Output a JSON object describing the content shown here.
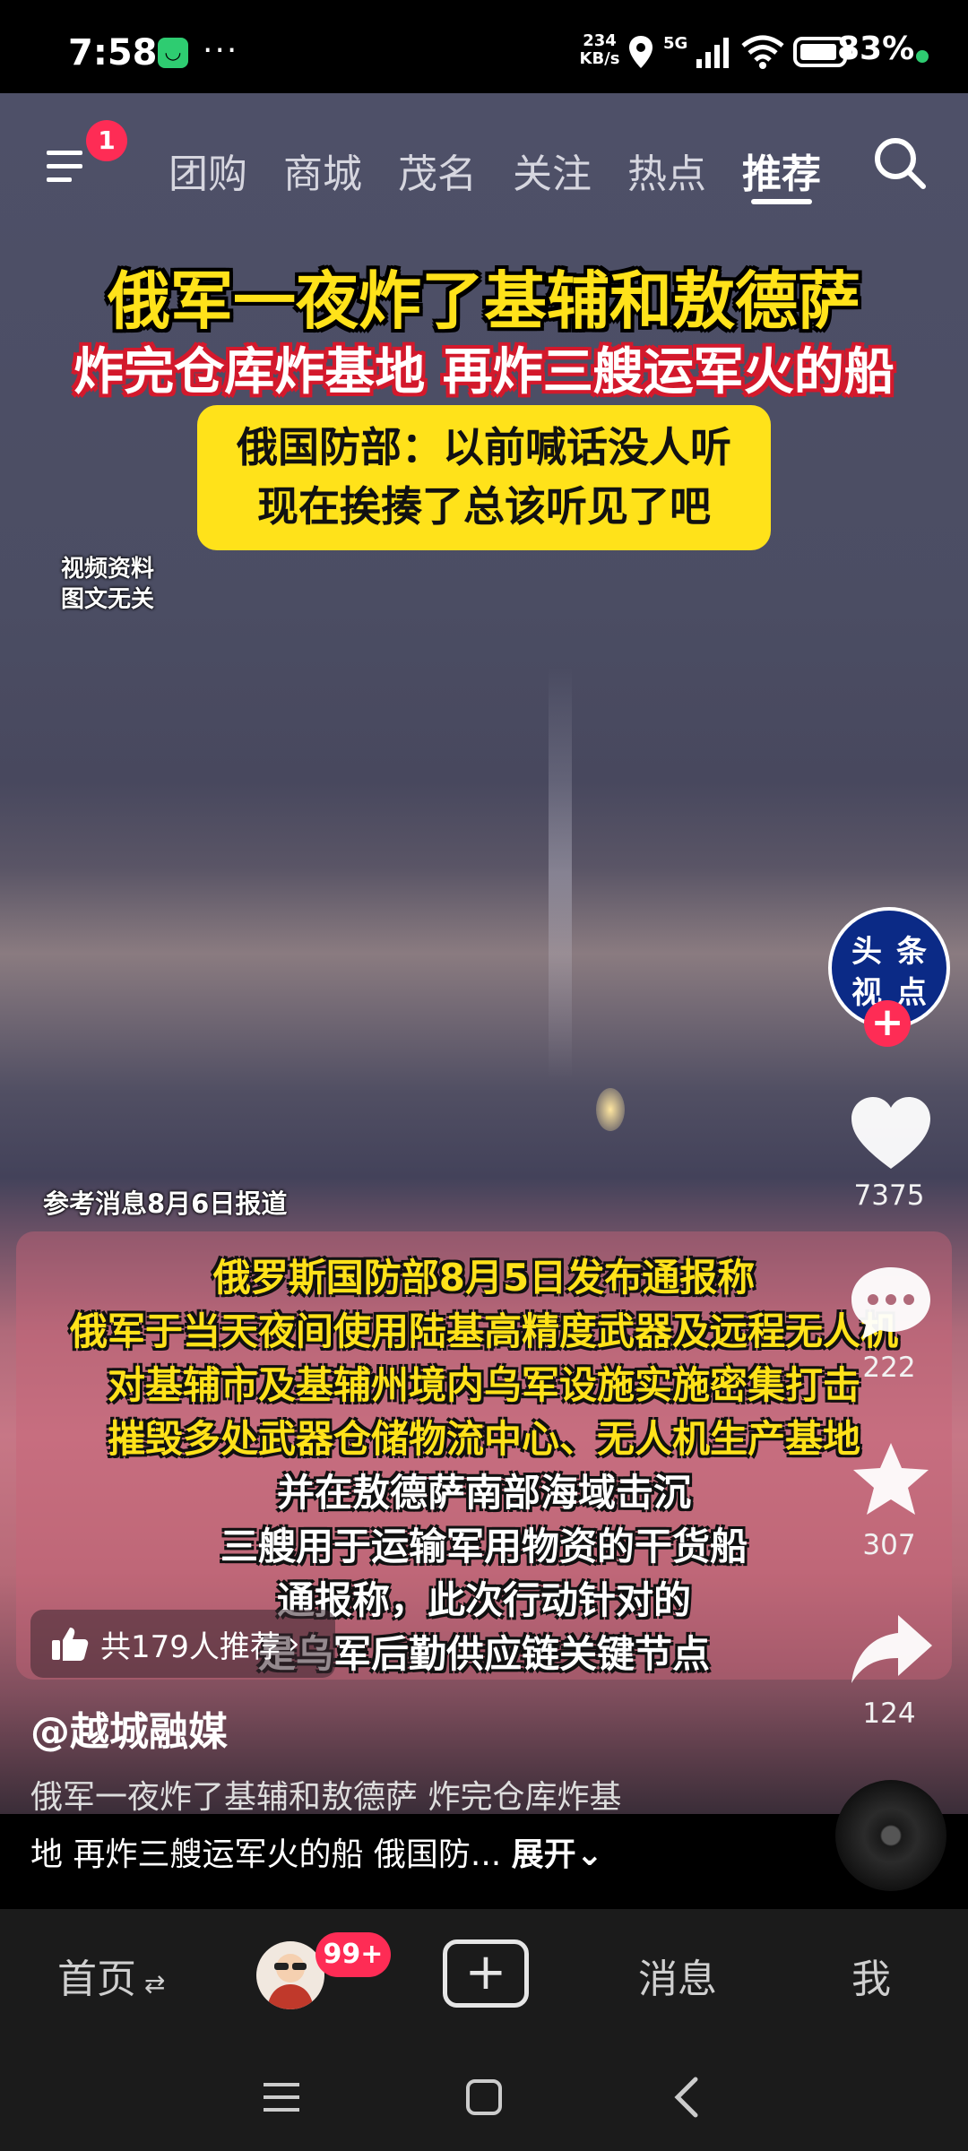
{
  "status_bar": {
    "time": "7:58",
    "dots": "···",
    "net_speed": "234 KB/s",
    "network": "5G",
    "battery": "83%"
  },
  "top_nav": {
    "menu_badge": "1",
    "tabs": [
      "团购",
      "商城",
      "茂名",
      "关注",
      "热点",
      "推荐"
    ],
    "active_tab": "推荐"
  },
  "video": {
    "headline_1": "俄军一夜炸了基辅和敖德萨",
    "headline_2": "炸完仓库炸基地 再炸三艘运军火的船",
    "box_line_1": "俄国防部：以前喊话没人听",
    "box_line_2": "现在挨揍了总该听见了吧",
    "disclaimer_1": "视频资料",
    "disclaimer_2": "图文无关",
    "source_label": "参考消息8月6日报道",
    "caption_lines": [
      "俄罗斯国防部8月5日发布通报称",
      "俄军于当天夜间使用陆基高精度武器及远程无人机",
      "对基辅市及基辅州境内乌军设施实施密集打击",
      "摧毁多处武器仓储物流中心、无人机生产基地",
      "并在敖德萨南部海域击沉",
      "三艘用于运输军用物资的干货船",
      "通报称，此次行动针对的",
      "是乌军后勤供应链关键节点"
    ]
  },
  "sidebar": {
    "avatar_text": [
      "头",
      "条",
      "视",
      "点"
    ],
    "likes": "7375",
    "comments": "222",
    "favorites": "307",
    "shares": "124"
  },
  "info": {
    "recommend": "共179人推荐",
    "author": "@越城融媒",
    "desc_line_1": "俄军一夜炸了基辅和敖德萨 炸完仓库炸基",
    "desc_line_2": "地 再炸三艘运军火的船 俄国防...",
    "expand": "展开"
  },
  "bottom_nav": {
    "home": "首页",
    "badge": "99+",
    "messages": "消息",
    "me": "我"
  },
  "colors": {
    "accent": "#fe2c55",
    "caption_yellow": "#ffe21a",
    "brand_blue": "#0b2a86"
  }
}
